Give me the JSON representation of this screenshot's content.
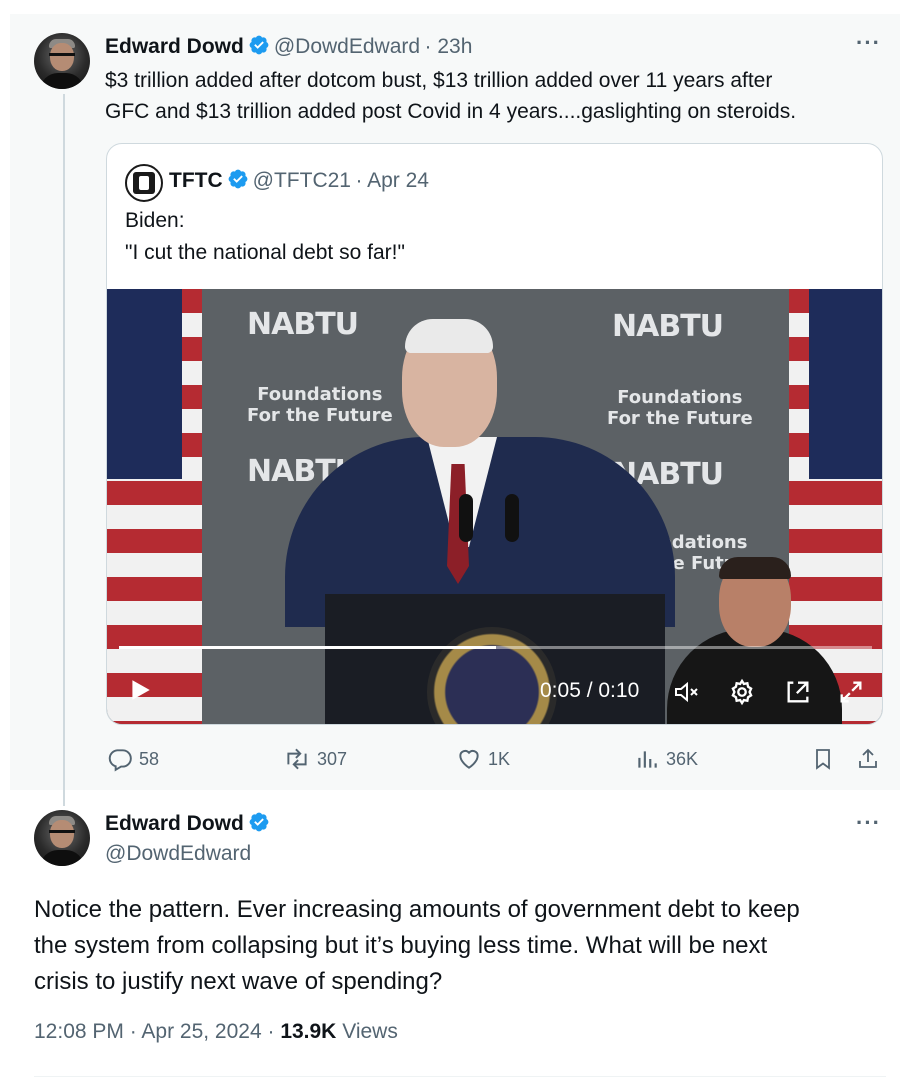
{
  "top_tweet": {
    "author_name": "Edward Dowd",
    "author_handle": "@DowdEdward",
    "time": "· 23h",
    "more": "···",
    "text_line1": "$3 trillion added after dotcom bust, $13 trillion added over 11 years after",
    "text_line2": "GFC and $13 trillion added post Covid in 4 years....gaslighting on steroids.",
    "quote": {
      "author_name": "TFTC",
      "author_handle": "@TFTC21",
      "date": "· Apr 24",
      "text_line1": "Biden:",
      "text_line2": "\"I cut the national debt so far!\"",
      "video": {
        "time_display": "0:05 / 0:10",
        "progress": 0.5,
        "backdrop_nabtu": "NABTU",
        "backdrop_foundations": "Foundations",
        "backdrop_future": "For the Future"
      }
    },
    "actions": {
      "replies": "58",
      "reposts": "307",
      "likes": "1K",
      "views": "36K"
    }
  },
  "reply_tweet": {
    "author_name": "Edward Dowd",
    "author_handle": "@DowdEdward",
    "more": "···",
    "text_line1": "Notice the pattern. Ever increasing amounts of government debt to keep",
    "text_line2": "the system from collapsing but it’s buying less time. What will be next",
    "text_line3": "crisis to justify next wave of spending?",
    "timestamp": "12:08 PM · Apr 25, 2024 · ",
    "views_count": "13.9K",
    "views_label": " Views"
  },
  "colors": {
    "verified_blue": "#1d9bf0",
    "muted_text": "#536471",
    "quote_bg": "#f7f9f9"
  }
}
